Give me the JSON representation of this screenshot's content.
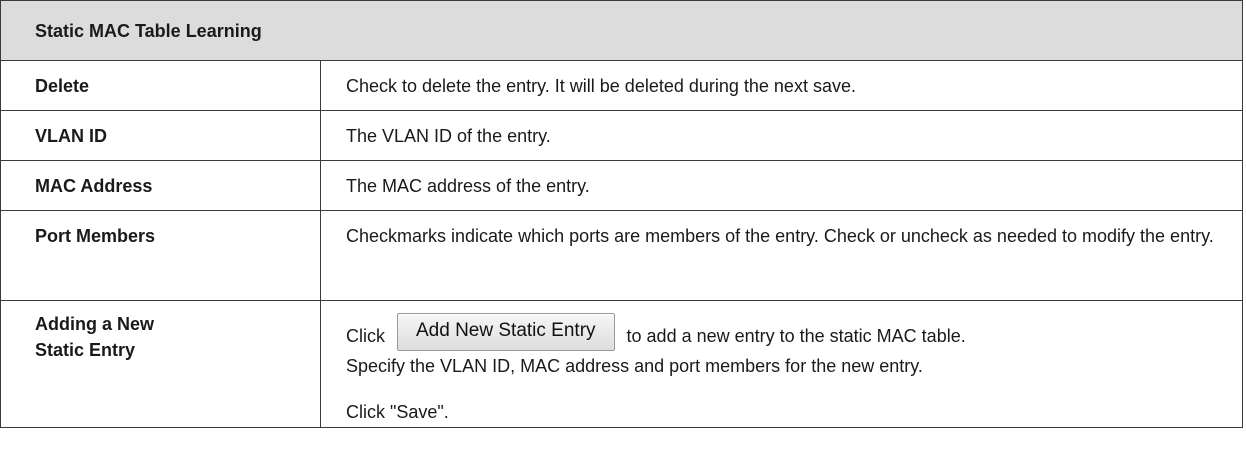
{
  "table": {
    "heading": "Static MAC Table Learning",
    "rows": [
      {
        "term": "Delete",
        "description": "Check to delete the entry. It will be deleted during the next save."
      },
      {
        "term": "VLAN ID",
        "description": "The VLAN ID of the entry."
      },
      {
        "term": "MAC Address",
        "description": "The MAC address of the entry."
      },
      {
        "term": "Port Members",
        "description": "Checkmarks indicate which ports are members of the entry. Check or uncheck as needed to modify the entry."
      }
    ],
    "add_entry": {
      "term_line1": "Adding a New",
      "term_line2": "Static Entry",
      "click_prefix": "Click",
      "button_label": "Add New Static Entry",
      "after_button": "to add a new entry to the static MAC table.",
      "line2": "Specify the VLAN ID, MAC address and port members for the new entry.",
      "line3": "Click \"Save\"."
    }
  }
}
